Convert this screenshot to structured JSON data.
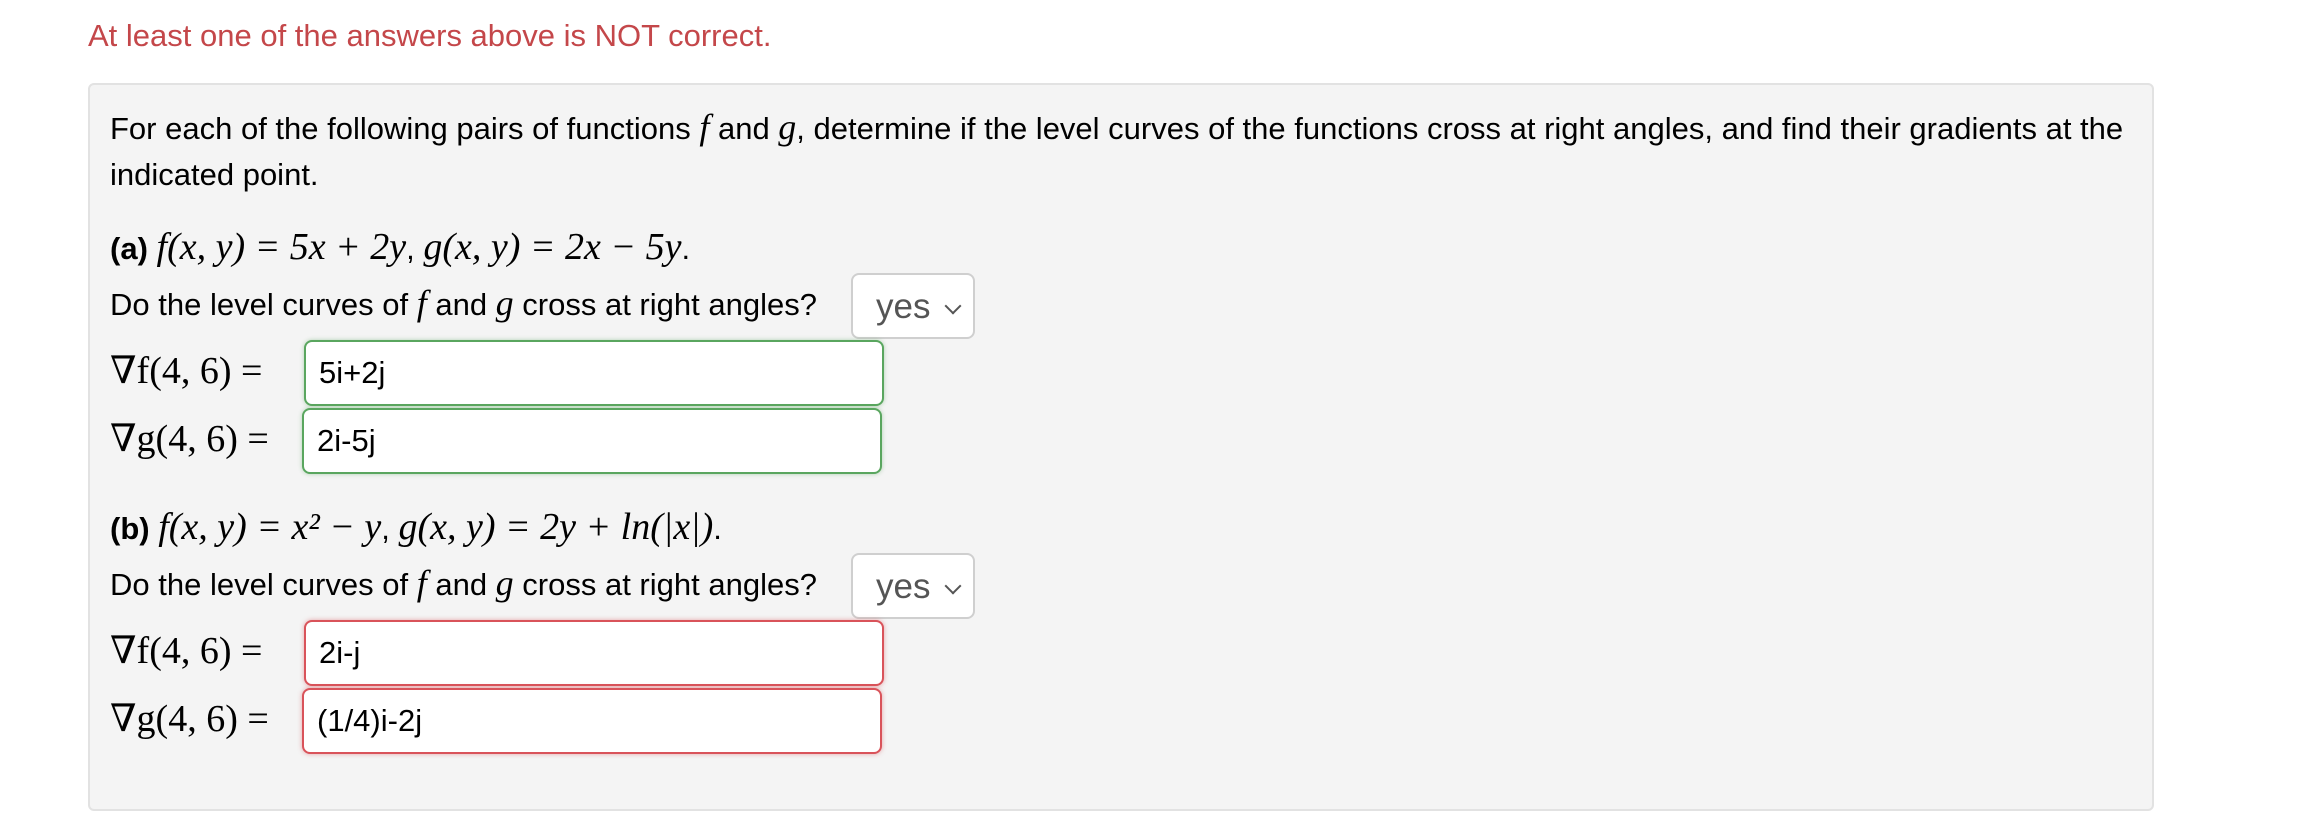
{
  "feedback": {
    "message": "At least one of the answers above is NOT correct."
  },
  "problem": {
    "intro_1": "For each of the following pairs of functions ",
    "intro_f": "f",
    "intro_2": " and ",
    "intro_g": "g",
    "intro_3": ", determine if the level curves of the functions cross at right angles, and find their gradients at the indicated point.",
    "parts": [
      {
        "label": "(a)",
        "f_expr": "f(x, y) = 5x + 2y",
        "g_expr": "g(x, y) = 2x − 5y",
        "question_1": "Do the level curves of ",
        "question_2": " and ",
        "question_3": " cross at right angles?",
        "select_value": "yes",
        "grad_f_label": "∇f(4, 6) =",
        "grad_f_value": "5i+2j",
        "grad_f_status": "correct",
        "grad_g_label": "∇g(4, 6) =",
        "grad_g_value": "2i-5j",
        "grad_g_status": "correct"
      },
      {
        "label": "(b)",
        "f_expr": "f(x, y) = x² − y",
        "g_expr": "g(x, y) = 2y + ln(|x|)",
        "question_1": "Do the level curves of ",
        "question_2": " and ",
        "question_3": " cross at right angles?",
        "select_value": "yes",
        "grad_f_label": "∇f(4, 6) =",
        "grad_f_value": "2i-j",
        "grad_f_status": "incorrect",
        "grad_g_label": "∇g(4, 6) =",
        "grad_g_value": "(1/4)i-2j",
        "grad_g_status": "incorrect"
      }
    ],
    "f_symbol": "f",
    "g_symbol": "g"
  },
  "colors": {
    "error_text": "#c4474a",
    "correct_border": "#5aa65f",
    "incorrect_border": "#d9535a",
    "panel_bg": "#f4f4f4"
  }
}
